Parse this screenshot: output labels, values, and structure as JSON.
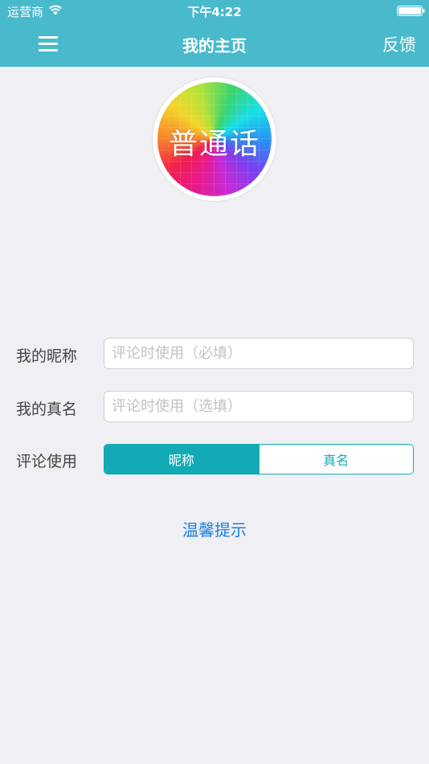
{
  "status_bar": {
    "carrier": "运营商",
    "time": "下午4:22",
    "icons": [
      "wifi-icon",
      "battery-icon"
    ]
  },
  "nav_bar": {
    "title": "我的主页",
    "feedback_label": "反馈",
    "menu_icon": "hamburger-menu-icon",
    "background_color": "#49b9cc"
  },
  "avatar": {
    "text": "普通话"
  },
  "form": {
    "nickname": {
      "label": "我的昵称",
      "value": "",
      "placeholder": "评论时使用（必填）"
    },
    "real_name": {
      "label": "我的真名",
      "value": "",
      "placeholder": "评论时使用（选填）"
    },
    "comment_as": {
      "label": "评论使用",
      "options": [
        "昵称",
        "真名"
      ],
      "selected": "昵称",
      "accent_color": "#13aab5"
    }
  },
  "tips_link": "温馨提示",
  "colors": {
    "page_background": "#efeff4",
    "link": "#1a7fe0"
  }
}
